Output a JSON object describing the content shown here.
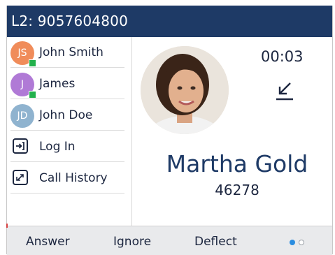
{
  "header": {
    "line_label": "L2: 9057604800"
  },
  "contacts": [
    {
      "initials": "JS",
      "name": "John Smith",
      "avatar_color": "#f08c5a",
      "presence": "available"
    },
    {
      "initials": "J",
      "name": "James",
      "avatar_color": "#b07ad6",
      "presence": "available"
    },
    {
      "initials": "JD",
      "name": "John Doe",
      "avatar_color": "#8fb3cf",
      "presence": "none"
    }
  ],
  "actions": [
    {
      "label": "Log In",
      "icon": "login-icon"
    },
    {
      "label": "Call History",
      "icon": "call-history-icon"
    }
  ],
  "call": {
    "timer": "00:03",
    "direction_icon": "incoming-call-arrow-icon",
    "caller_name": "Martha Gold",
    "caller_number": "46278"
  },
  "softkeys": {
    "answer": "Answer",
    "ignore": "Ignore",
    "deflect": "Deflect"
  },
  "pagination": {
    "pages": 2,
    "current": 1
  },
  "colors": {
    "header_bg": "#1e3a66",
    "presence_green": "#22b14c",
    "page_dot_active": "#2a8de0",
    "softkey_bar_bg": "#e9eaec"
  }
}
